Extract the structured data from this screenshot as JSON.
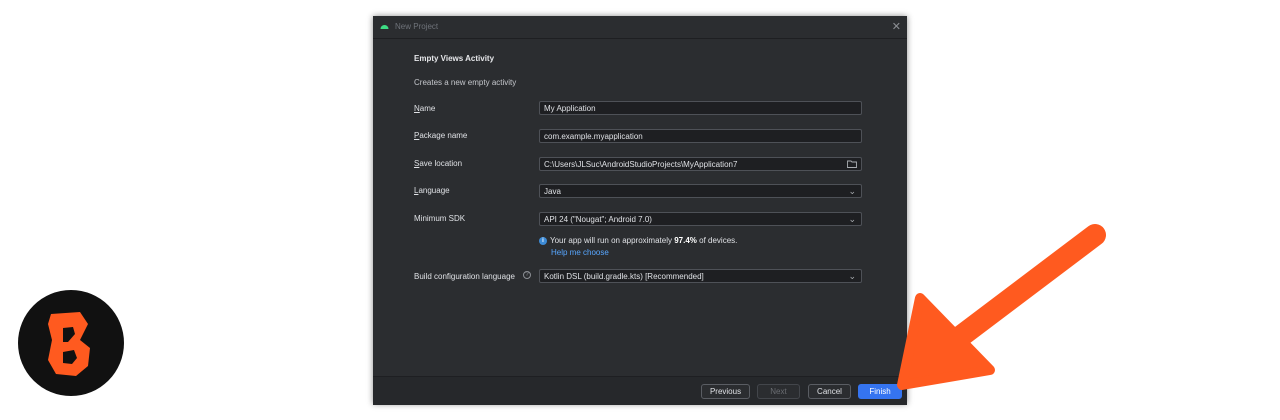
{
  "window": {
    "title": "New Project"
  },
  "template": {
    "heading": "Empty Views Activity",
    "description": "Creates a new empty activity"
  },
  "form": {
    "name": {
      "label_accel": "N",
      "label_rest": "ame",
      "value": "My Application"
    },
    "package": {
      "label_accel": "P",
      "label_rest": "ackage name",
      "value": "com.example.myapplication"
    },
    "save_location": {
      "label_accel": "S",
      "label_rest": "ave location",
      "value": "C:\\Users\\JLSuc\\AndroidStudioProjects\\MyApplication7"
    },
    "language": {
      "label_accel": "L",
      "label_rest": "anguage",
      "value": "Java"
    },
    "min_sdk": {
      "label": "Minimum SDK",
      "value": "API 24 (\"Nougat\"; Android 7.0)"
    },
    "sdk_info": {
      "prefix": "Your app will run on approximately ",
      "percent": "97.4%",
      "suffix": " of devices.",
      "help_link": "Help me choose"
    },
    "build_config": {
      "label": "Build configuration language",
      "value": "Kotlin DSL (build.gradle.kts) [Recommended]"
    }
  },
  "buttons": {
    "previous": "Previous",
    "next": "Next",
    "cancel": "Cancel",
    "finish": "Finish"
  },
  "colors": {
    "dialog_bg": "#2b2d30",
    "primary_button": "#3574f0",
    "link": "#57a6ff",
    "arrow": "#ff5a1f",
    "logo_accent": "#ff5a1f"
  }
}
